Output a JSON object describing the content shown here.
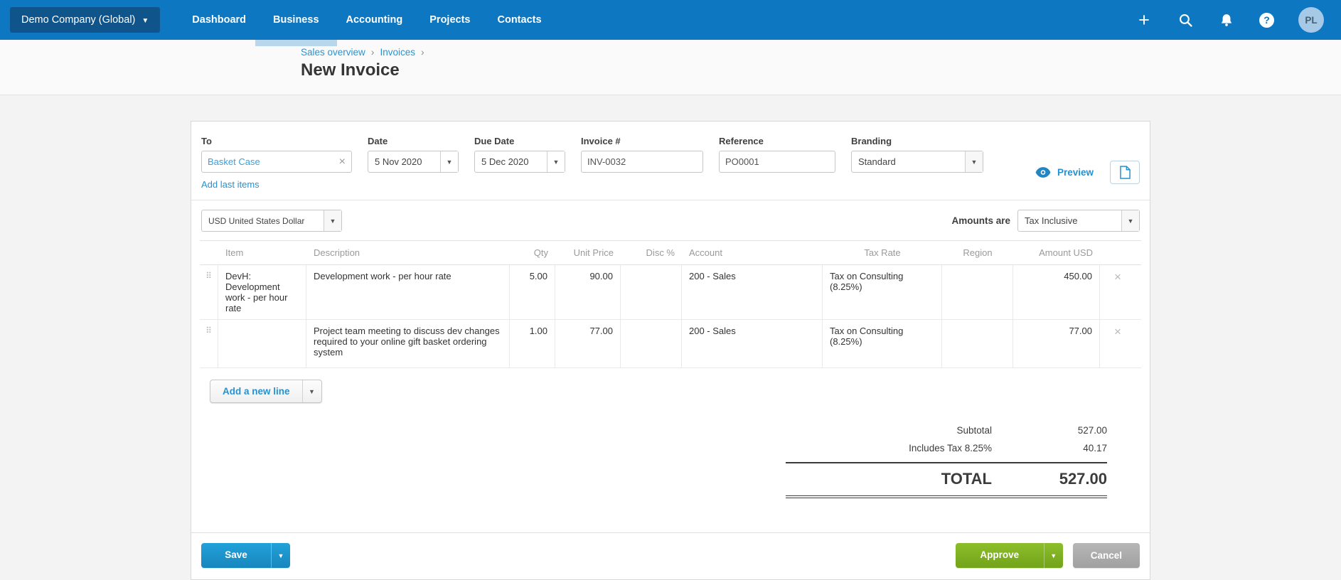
{
  "nav": {
    "company": "Demo Company (Global)",
    "items": [
      {
        "label": "Dashboard",
        "active": false
      },
      {
        "label": "Business",
        "active": true
      },
      {
        "label": "Accounting",
        "active": false
      },
      {
        "label": "Projects",
        "active": false
      },
      {
        "label": "Contacts",
        "active": false
      }
    ],
    "avatar_initials": "PL"
  },
  "breadcrumb": {
    "links": [
      "Sales overview",
      "Invoices"
    ],
    "separator": "›"
  },
  "page_title": "New Invoice",
  "invoice_fields": {
    "to": {
      "label": "To",
      "value": "Basket Case"
    },
    "add_last_items_label": "Add last items",
    "date": {
      "label": "Date",
      "value": "5 Nov 2020"
    },
    "due_date": {
      "label": "Due Date",
      "value": "5 Dec 2020"
    },
    "invoice_number": {
      "label": "Invoice #",
      "value": "INV-0032"
    },
    "reference": {
      "label": "Reference",
      "value": "PO0001"
    },
    "branding": {
      "label": "Branding",
      "value": "Standard"
    },
    "preview_label": "Preview",
    "currency": "USD United States Dollar",
    "amounts_are": {
      "label": "Amounts are",
      "value": "Tax Inclusive"
    }
  },
  "line_items": {
    "headers": [
      "Item",
      "Description",
      "Qty",
      "Unit Price",
      "Disc %",
      "Account",
      "Tax Rate",
      "Region",
      "Amount USD"
    ],
    "rows": [
      {
        "item": "DevH: Development work - per hour rate",
        "description": "Development work - per hour rate",
        "qty": "5.00",
        "unit_price": "90.00",
        "disc": "",
        "account": "200 - Sales",
        "tax_rate": "Tax on Consulting (8.25%)",
        "region": "",
        "amount": "450.00"
      },
      {
        "item": "",
        "description": "Project team meeting to discuss dev changes required to your online gift basket ordering system",
        "qty": "1.00",
        "unit_price": "77.00",
        "disc": "",
        "account": "200 - Sales",
        "tax_rate": "Tax on Consulting (8.25%)",
        "region": "",
        "amount": "77.00"
      }
    ],
    "add_line_label": "Add a new line"
  },
  "totals": {
    "subtotal_label": "Subtotal",
    "subtotal": "527.00",
    "tax_label": "Includes Tax 8.25%",
    "tax": "40.17",
    "total_label": "TOTAL",
    "total": "527.00"
  },
  "actions": {
    "save": "Save",
    "approve": "Approve",
    "cancel": "Cancel"
  },
  "colors": {
    "nav_bar": "#0d77c2",
    "company_button": "#0f548a",
    "active_tab_indicator": "#b9d7ec",
    "link_blue": "#2691cf",
    "contact_text": "#3aa0dc",
    "save_button": "#1b95cc",
    "approve_button": "#7cb021",
    "cancel_button": "#ababab"
  }
}
